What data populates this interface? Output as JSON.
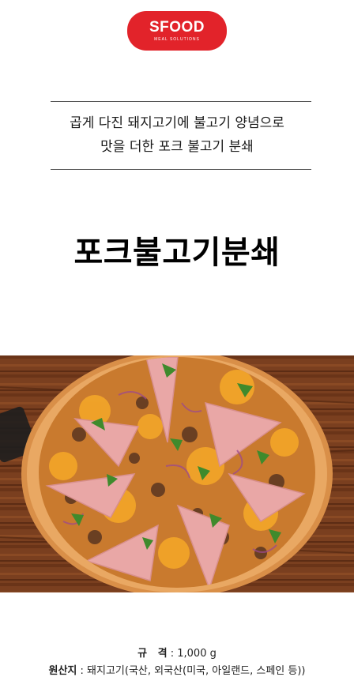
{
  "brand": {
    "name": "SFOOD",
    "subtitle": "MEAL SOLUTIONS",
    "color": "#e2232a"
  },
  "tagline": {
    "line1": "곱게 다진 돼지고기에 불고기 양념으로",
    "line2": "맛을 더한 포크 불고기 분쇄"
  },
  "product_title": "포크불고기분쇄",
  "specs": {
    "size_label": "규   격",
    "size_value": ": 1,000 g",
    "origin_label": "원산지",
    "origin_value": ": 돼지고기(국산, 외국산(미국, 아일랜드, 스페인 등))"
  }
}
